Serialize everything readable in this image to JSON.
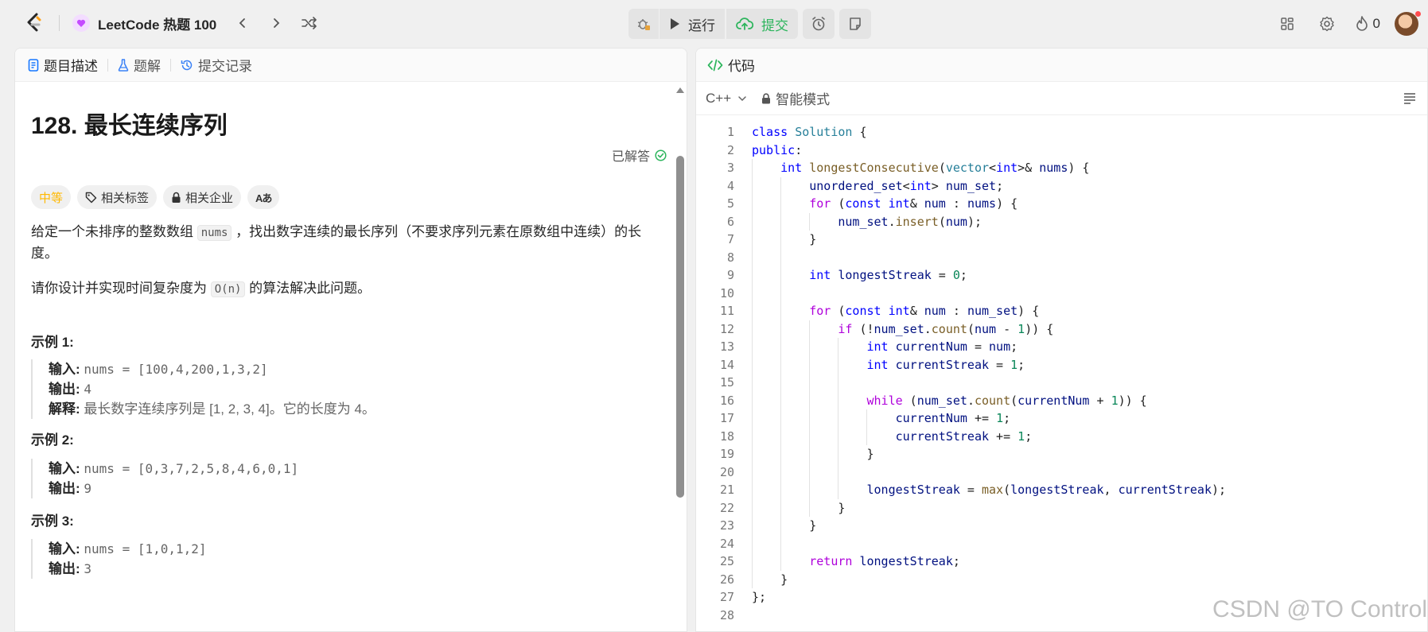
{
  "topbar": {
    "problem_list_title": "LeetCode 热题 100",
    "run_label": "运行",
    "submit_label": "提交",
    "streak_count": "0",
    "colors": {
      "submit": "#2db55d",
      "logo_orange": "#ffa116"
    }
  },
  "left": {
    "tabs": [
      {
        "label": "题目描述",
        "icon": "description-icon"
      },
      {
        "label": "题解",
        "icon": "flask-icon"
      },
      {
        "label": "提交记录",
        "icon": "history-icon"
      }
    ],
    "title": "128. 最长连续序列",
    "solved_label": "已解答",
    "tags": {
      "difficulty": "中等",
      "topics": "相关标签",
      "companies": "相关企业",
      "font_toggle": "Aあ"
    },
    "desc": {
      "p1_a": "给定一个未排序的整数数组 ",
      "p1_code": "nums",
      "p1_b": " ，找出数字连续的最长序列（不要求序列元素在原数组中连续）的长度。",
      "p2_a": "请你设计并实现时间复杂度为 ",
      "p2_code": "O(n)",
      "p2_b": " 的算法解决此问题。"
    },
    "examples": [
      {
        "heading": "示例 1:",
        "input_key": "输入:",
        "input": "nums = [100,4,200,1,3,2]",
        "output_key": "输出:",
        "output": "4",
        "explain_key": "解释:",
        "explain": "最长数字连续序列是 [1, 2, 3, 4]。它的长度为 4。"
      },
      {
        "heading": "示例 2:",
        "input_key": "输入:",
        "input": "nums = [0,3,7,2,5,8,4,6,0,1]",
        "output_key": "输出:",
        "output": "9"
      },
      {
        "heading": "示例 3:",
        "input_key": "输入:",
        "input": "nums = [1,0,1,2]",
        "output_key": "输出:",
        "output": "3"
      }
    ]
  },
  "right": {
    "header_label": "代码",
    "language": "C++",
    "mode_label": "智能模式",
    "watermark": "CSDN @TO Control"
  }
}
